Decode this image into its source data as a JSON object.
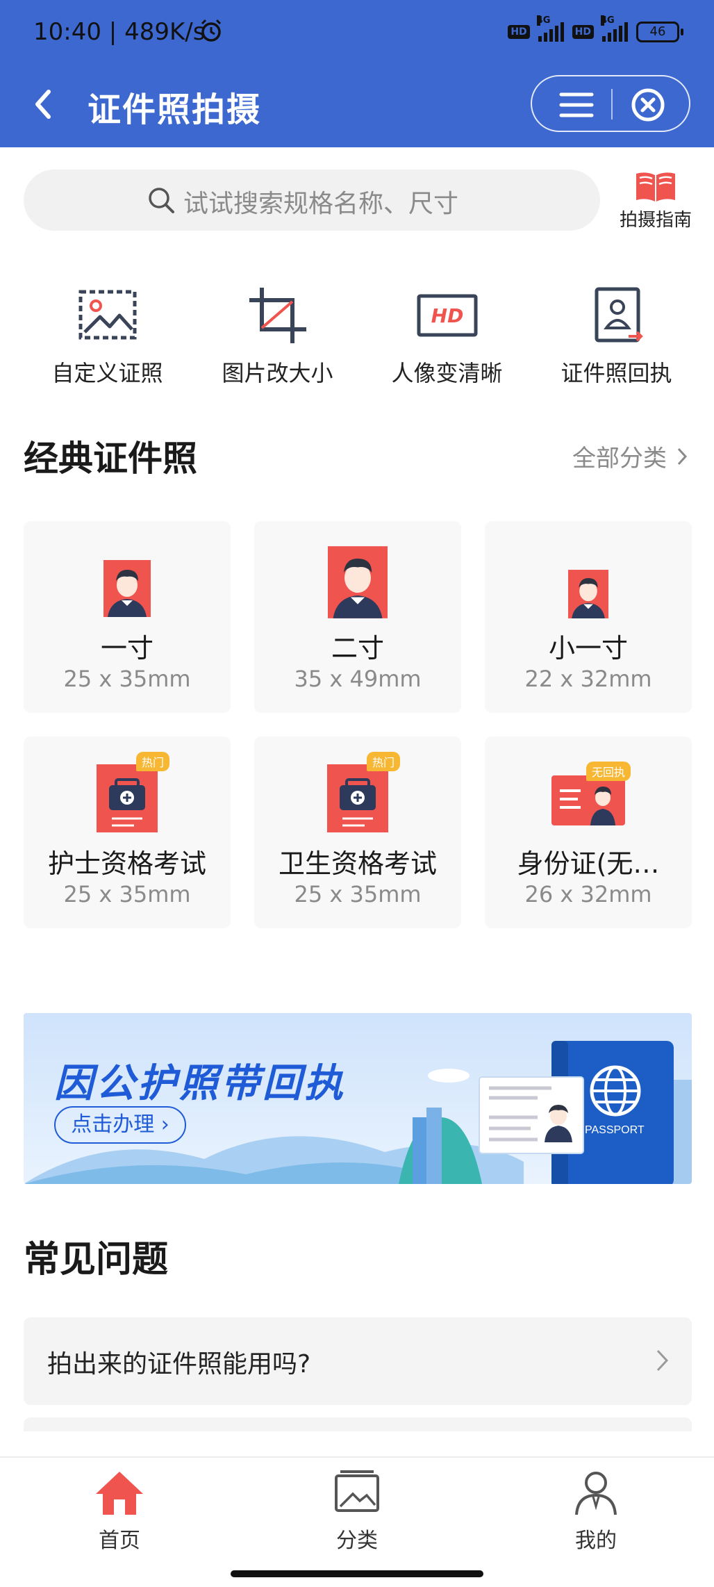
{
  "status_bar": {
    "time": "10:40",
    "speed": "489K/s",
    "alarm_icon": "alarm-clock-icon",
    "network": [
      "HD 4G",
      "HD 4G"
    ],
    "battery": "46"
  },
  "header": {
    "title": "证件照拍摄",
    "back_icon": "chevron-left-icon",
    "menu_icon": "hamburger-menu-icon",
    "close_icon": "close-circle-icon"
  },
  "search": {
    "placeholder": "试试搜索规格名称、尺寸",
    "guide_label": "拍摄指南"
  },
  "tools": [
    {
      "label": "自定义证照",
      "icon": "custom-photo-icon"
    },
    {
      "label": "图片改大小",
      "icon": "crop-icon"
    },
    {
      "label": "人像变清晰",
      "icon": "hd-icon"
    },
    {
      "label": "证件照回执",
      "icon": "receipt-portrait-icon"
    }
  ],
  "classic": {
    "title": "经典证件照",
    "more": "全部分类",
    "cards": [
      {
        "name": "一寸",
        "size": "25 x 35mm"
      },
      {
        "name": "二寸",
        "size": "35 x 49mm"
      },
      {
        "name": "小一寸",
        "size": "22 x 32mm"
      },
      {
        "name": "护士资格考试",
        "size": "25 x 35mm",
        "badge": "热门"
      },
      {
        "name": "卫生资格考试",
        "size": "25 x 35mm",
        "badge": "热门"
      },
      {
        "name": "身份证(无…",
        "size": "26 x 32mm",
        "badge": "无回执"
      }
    ]
  },
  "banner": {
    "title": "因公护照带回执",
    "button": "点击办理 ›",
    "passport_text": "PASSPORT"
  },
  "faq": {
    "title": "常见问题",
    "items": [
      {
        "question": "拍出来的证件照能用吗?"
      }
    ]
  },
  "bottom_nav": [
    {
      "label": "首页",
      "icon": "home-icon",
      "active": true
    },
    {
      "label": "分类",
      "icon": "category-icon",
      "active": false
    },
    {
      "label": "我的",
      "icon": "profile-icon",
      "active": false
    }
  ],
  "colors": {
    "header_bg": "#3c68cf",
    "accent_red": "#f0544f",
    "badge_yellow": "#f7b733",
    "banner_blue": "#1f5bd6"
  }
}
